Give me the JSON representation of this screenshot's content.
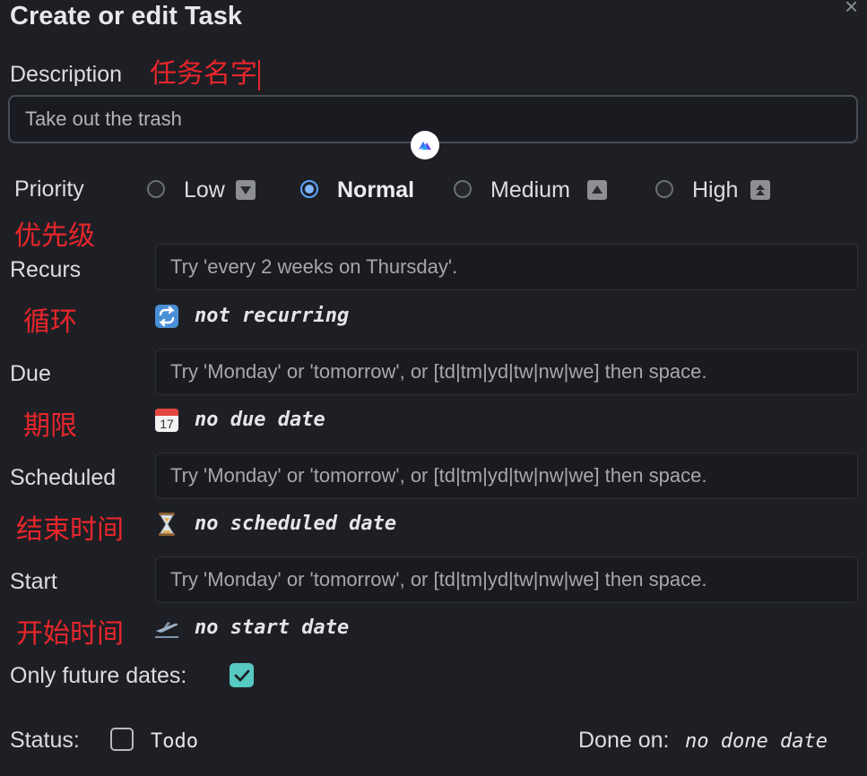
{
  "window": {
    "title": "Create or edit Task",
    "close_glyph": "×"
  },
  "description": {
    "label": "Description",
    "annotation": "任务名字",
    "value": "Take out the trash"
  },
  "priority": {
    "label": "Priority",
    "annotation": "优先级",
    "options": [
      {
        "label": "Low",
        "selected": false,
        "icon": "priority-low-icon"
      },
      {
        "label": "Normal",
        "selected": true,
        "icon": null
      },
      {
        "label": "Medium",
        "selected": false,
        "icon": "priority-medium-icon"
      },
      {
        "label": "High",
        "selected": false,
        "icon": "priority-high-icon"
      }
    ]
  },
  "recurs": {
    "label": "Recurs",
    "annotation": "循环",
    "placeholder": "Try 'every 2 weeks on Thursday'.",
    "status": "not recurring",
    "icon": "repeat-icon"
  },
  "due": {
    "label": "Due",
    "annotation": "期限",
    "placeholder": "Try 'Monday' or 'tomorrow', or [td|tm|yd|tw|nw|we] then space.",
    "status": "no due date",
    "icon": "calendar-icon",
    "icon_text": "17"
  },
  "scheduled": {
    "label": "Scheduled",
    "annotation": "结束时间",
    "placeholder": "Try 'Monday' or 'tomorrow', or [td|tm|yd|tw|nw|we] then space.",
    "status": "no scheduled date",
    "icon": "hourglass-icon"
  },
  "start": {
    "label": "Start",
    "annotation": "开始时间",
    "placeholder": "Try 'Monday' or 'tomorrow', or [td|tm|yd|tw|nw|we] then space.",
    "status": "no start date",
    "icon": "airplane-departure-icon"
  },
  "only_future": {
    "label": "Only future dates:",
    "checked": true
  },
  "status_row": {
    "label": "Status:",
    "todo_label": "Todo",
    "todo_checked": false,
    "done_label": "Done on:",
    "done_value": "no done date"
  },
  "colors": {
    "background": "#1e1f25",
    "annotation_red": "#e8262b",
    "accent_blue": "#5aa3ff",
    "checkbox_teal": "#56c9c1"
  }
}
